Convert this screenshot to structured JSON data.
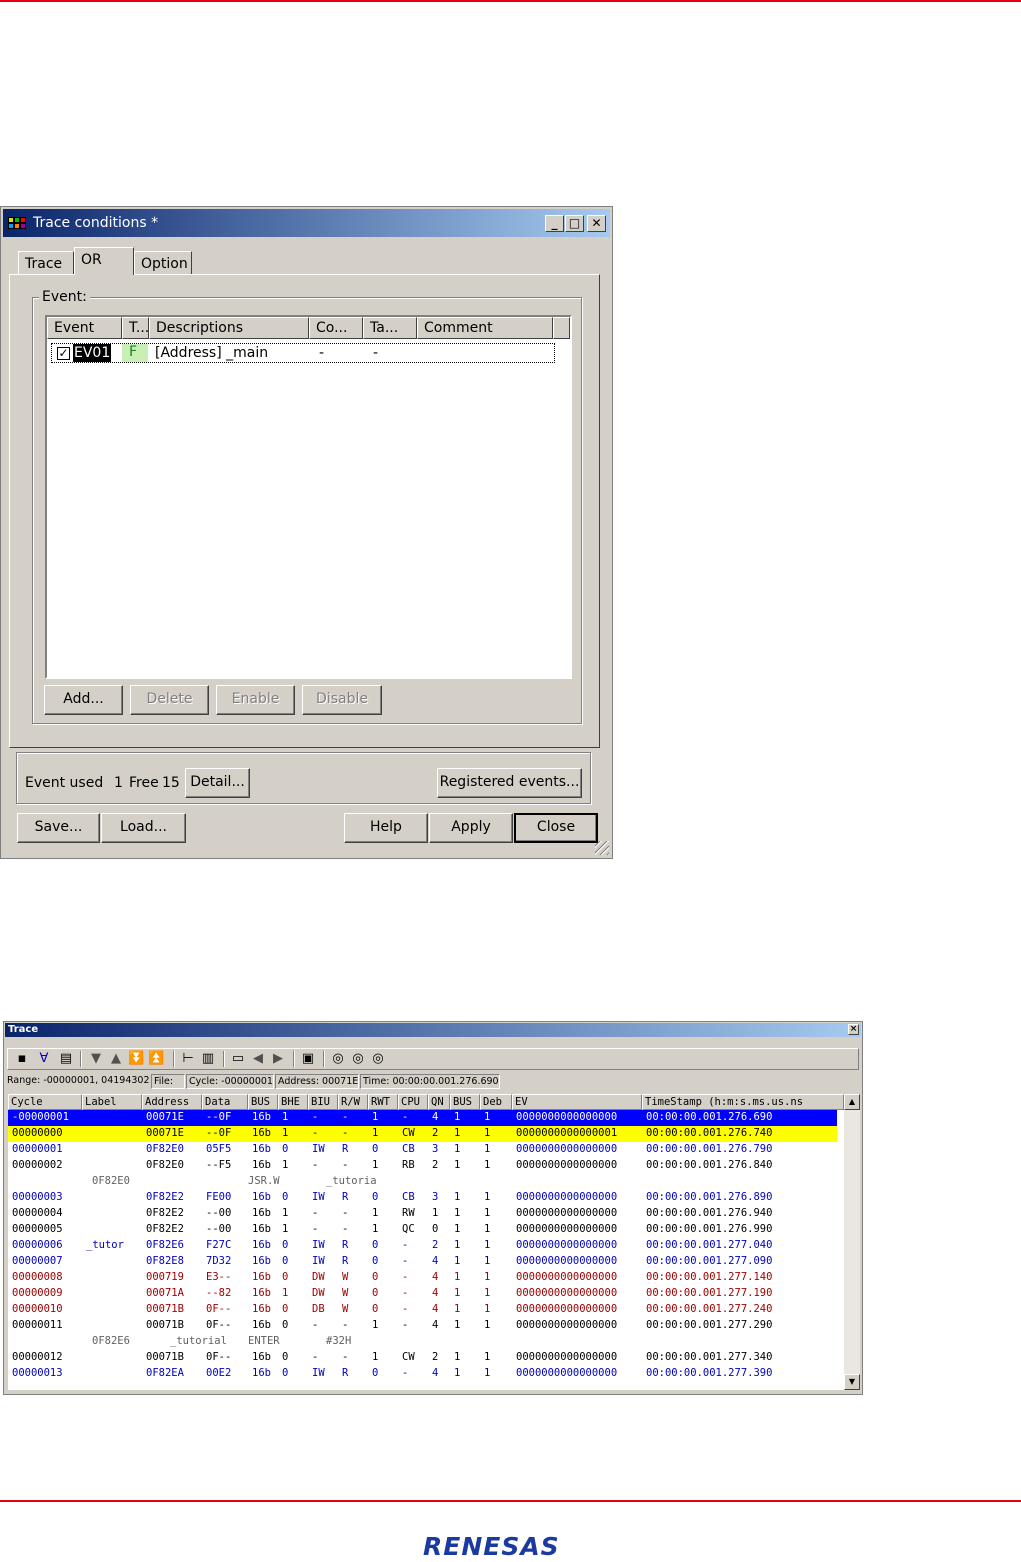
{
  "dialog": {
    "title": "Trace conditions *",
    "tabs": [
      {
        "label": "Trace"
      },
      {
        "label": "OR"
      },
      {
        "label": "Option"
      }
    ],
    "active_tab": "OR",
    "event_group_label": "Event:",
    "columns": [
      "Event",
      "T...",
      "Descriptions",
      "Co...",
      "Ta...",
      "Comment"
    ],
    "rows": [
      {
        "checked": true,
        "event": "EV01",
        "type": "F",
        "description": "[Address] _main",
        "count": "-",
        "target": "-",
        "comment": ""
      }
    ],
    "buttons": {
      "add": "Add...",
      "delete": "Delete",
      "enable": "Enable",
      "disable": "Disable"
    },
    "status": {
      "event_used_label": "Event used",
      "used": "1",
      "free_label": "Free",
      "free": "15",
      "detail": "Detail...",
      "registered": "Registered events..."
    },
    "footer": {
      "save": "Save...",
      "load": "Load...",
      "help": "Help",
      "apply": "Apply",
      "close": "Close"
    }
  },
  "trace": {
    "title": "Trace",
    "close_glyph": "×",
    "toolbar_icons": [
      "mode-icon",
      "filter-icon",
      "document-icon",
      "down-icon",
      "up-icon",
      "bottom-icon",
      "top-icon",
      "tree-icon",
      "column-icon",
      "window-icon",
      "left-arrow-icon",
      "right-arrow-icon",
      "properties-icon",
      "find-icon",
      "find-next-icon",
      "find-prev-icon"
    ],
    "info": {
      "range": "Range: -00000001, 04194302",
      "file": "File:",
      "cycle": "Cycle: -00000001",
      "address": "Address: 00071E",
      "time": "Time: 00:00:00.001.276.690"
    },
    "columns": [
      "Cycle",
      "Label",
      "Address",
      "Data",
      "BUS",
      "BHE",
      "BIU",
      "R/W",
      "RWT",
      "CPU",
      "QN",
      "BUS",
      "Deb",
      "EV",
      "TimeStamp (h:m:s.ms.us.ns"
    ],
    "colors": {
      "blue": "#0000c0",
      "red": "#a00000",
      "black": "#000000",
      "gray": "#606060",
      "selected_bg": "#0000ff",
      "highlight_bg": "#ffff00"
    },
    "rows": [
      {
        "style": "selected",
        "cells": [
          "-00000001",
          "",
          "00071E",
          "--0F",
          "16b",
          "1",
          "-",
          "-",
          "1",
          "-",
          "4",
          "1",
          "1",
          "0000000000000000",
          "00:00:00.001.276.690"
        ]
      },
      {
        "style": "highlight",
        "cells": [
          "00000000",
          "",
          "00071E",
          "--0F",
          "16b",
          "1",
          "-",
          "-",
          "1",
          "CW",
          "2",
          "1",
          "1",
          "0000000000000001",
          "00:00:00.001.276.740"
        ]
      },
      {
        "style": "blue",
        "cells": [
          "00000001",
          "",
          "0F82E0",
          "05F5",
          "16b",
          "0",
          "IW",
          "R",
          "0",
          "CB",
          "3",
          "1",
          "1",
          "0000000000000000",
          "00:00:00.001.276.790"
        ]
      },
      {
        "style": "black",
        "cells": [
          "00000002",
          "",
          "0F82E0",
          "--F5",
          "16b",
          "1",
          "-",
          "-",
          "1",
          "RB",
          "2",
          "1",
          "1",
          "0000000000000000",
          "00:00:00.001.276.840"
        ]
      },
      {
        "style": "disasm",
        "disasm": [
          "0F82E0",
          "JSR.W",
          "_tutoria"
        ]
      },
      {
        "style": "blue",
        "cells": [
          "00000003",
          "",
          "0F82E2",
          "FE00",
          "16b",
          "0",
          "IW",
          "R",
          "0",
          "CB",
          "3",
          "1",
          "1",
          "0000000000000000",
          "00:00:00.001.276.890"
        ]
      },
      {
        "style": "black",
        "cells": [
          "00000004",
          "",
          "0F82E2",
          "--00",
          "16b",
          "1",
          "-",
          "-",
          "1",
          "RW",
          "1",
          "1",
          "1",
          "0000000000000000",
          "00:00:00.001.276.940"
        ]
      },
      {
        "style": "black",
        "cells": [
          "00000005",
          "",
          "0F82E2",
          "--00",
          "16b",
          "1",
          "-",
          "-",
          "1",
          "QC",
          "0",
          "1",
          "1",
          "0000000000000000",
          "00:00:00.001.276.990"
        ]
      },
      {
        "style": "blue",
        "cells": [
          "00000006",
          "_tutor",
          "0F82E6",
          "F27C",
          "16b",
          "0",
          "IW",
          "R",
          "0",
          "-",
          "2",
          "1",
          "1",
          "0000000000000000",
          "00:00:00.001.277.040"
        ]
      },
      {
        "style": "blue",
        "cells": [
          "00000007",
          "",
          "0F82E8",
          "7D32",
          "16b",
          "0",
          "IW",
          "R",
          "0",
          "-",
          "4",
          "1",
          "1",
          "0000000000000000",
          "00:00:00.001.277.090"
        ]
      },
      {
        "style": "red",
        "cells": [
          "00000008",
          "",
          "000719",
          "E3--",
          "16b",
          "0",
          "DW",
          "W",
          "0",
          "-",
          "4",
          "1",
          "1",
          "0000000000000000",
          "00:00:00.001.277.140"
        ]
      },
      {
        "style": "red",
        "cells": [
          "00000009",
          "",
          "00071A",
          "--82",
          "16b",
          "1",
          "DW",
          "W",
          "0",
          "-",
          "4",
          "1",
          "1",
          "0000000000000000",
          "00:00:00.001.277.190"
        ]
      },
      {
        "style": "red",
        "cells": [
          "00000010",
          "",
          "00071B",
          "0F--",
          "16b",
          "0",
          "DB",
          "W",
          "0",
          "-",
          "4",
          "1",
          "1",
          "0000000000000000",
          "00:00:00.001.277.240"
        ]
      },
      {
        "style": "black",
        "cells": [
          "00000011",
          "",
          "00071B",
          "0F--",
          "16b",
          "0",
          "-",
          "-",
          "1",
          "-",
          "4",
          "1",
          "1",
          "0000000000000000",
          "00:00:00.001.277.290"
        ]
      },
      {
        "style": "disasm",
        "disasm": [
          "0F82E6",
          "_tutorial",
          "ENTER",
          "#32H"
        ]
      },
      {
        "style": "black",
        "cells": [
          "00000012",
          "",
          "00071B",
          "0F--",
          "16b",
          "0",
          "-",
          "-",
          "1",
          "CW",
          "2",
          "1",
          "1",
          "0000000000000000",
          "00:00:00.001.277.340"
        ]
      },
      {
        "style": "blue",
        "cells": [
          "00000013",
          "",
          "0F82EA",
          "00E2",
          "16b",
          "0",
          "IW",
          "R",
          "0",
          "-",
          "4",
          "1",
          "1",
          "0000000000000000",
          "00:00:00.001.277.390"
        ]
      }
    ]
  },
  "footer": {
    "logo_text": "RENESAS"
  }
}
